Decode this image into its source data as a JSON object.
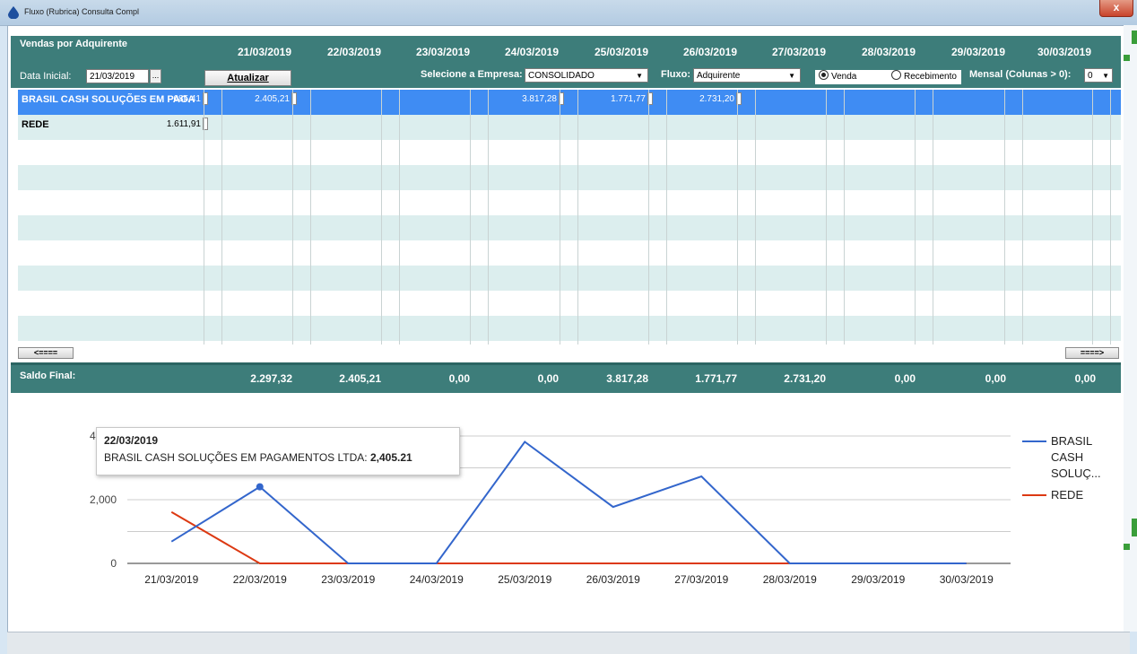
{
  "window": {
    "title": "Fluxo (Rubrica) Consulta Compl",
    "close_glyph": "x"
  },
  "header": {
    "title": "Vendas por Adquirente",
    "dates": [
      "21/03/2019",
      "22/03/2019",
      "23/03/2019",
      "24/03/2019",
      "25/03/2019",
      "26/03/2019",
      "27/03/2019",
      "28/03/2019",
      "29/03/2019",
      "30/03/2019"
    ],
    "data_inicial_label": "Data Inicial:",
    "data_inicial_value": "21/03/2019",
    "ellipsis_label": "...",
    "atualizar_label": "Atualizar",
    "empresa_label": "Selecione a Empresa:",
    "empresa_value": "CONSOLIDADO",
    "fluxo_label": "Fluxo:",
    "fluxo_value": "Adquirente",
    "radio_venda": "Venda",
    "radio_recebimento": "Recebimento",
    "radio_selected": "Venda",
    "mensal_label": "Mensal (Colunas > 0):",
    "mensal_value": "0"
  },
  "grid": {
    "rows": [
      {
        "name": "BRASIL CASH SOLUÇÕES EM PAGA",
        "values": [
          "685,41",
          "2.405,21",
          "",
          "",
          "3.817,28",
          "1.771,77",
          "2.731,20",
          "",
          "",
          ""
        ],
        "selected": true
      },
      {
        "name": "REDE",
        "values": [
          "1.611,91",
          "",
          "",
          "",
          "",
          "",
          "",
          "",
          "",
          ""
        ],
        "selected": false
      }
    ],
    "empty_rows": 8
  },
  "scroll": {
    "left_label": "<====",
    "right_label": "====>"
  },
  "saldo": {
    "label": "Saldo Final:",
    "values": [
      "2.297,32",
      "2.405,21",
      "0,00",
      "0,00",
      "3.817,28",
      "1.771,77",
      "2.731,20",
      "0,00",
      "0,00",
      "0,00"
    ]
  },
  "chart_data": {
    "type": "line",
    "categories": [
      "21/03/2019",
      "22/03/2019",
      "23/03/2019",
      "24/03/2019",
      "25/03/2019",
      "26/03/2019",
      "27/03/2019",
      "28/03/2019",
      "29/03/2019",
      "30/03/2019"
    ],
    "series": [
      {
        "name": "BRASIL CASH SOLUÇ...",
        "legend_lines": [
          "BRASIL",
          "CASH",
          "SOLUÇ..."
        ],
        "color": "#3366cc",
        "values": [
          685.41,
          2405.21,
          0,
          0,
          3817.28,
          1771.77,
          2731.2,
          0,
          0,
          0
        ]
      },
      {
        "name": "REDE",
        "legend_lines": [
          "REDE"
        ],
        "color": "#dc3912",
        "values": [
          1611.91,
          0,
          0,
          0,
          0,
          0,
          0,
          0,
          0,
          0
        ]
      }
    ],
    "yticks": [
      "0",
      "2,000",
      "4,000"
    ],
    "ylim": [
      0,
      4000
    ],
    "grid": true,
    "legend": "right",
    "tooltip": {
      "date": "22/03/2019",
      "label": "BRASIL CASH SOLUÇÕES EM PAGAMENTOS LTDA:",
      "value": "2,405.21"
    }
  }
}
